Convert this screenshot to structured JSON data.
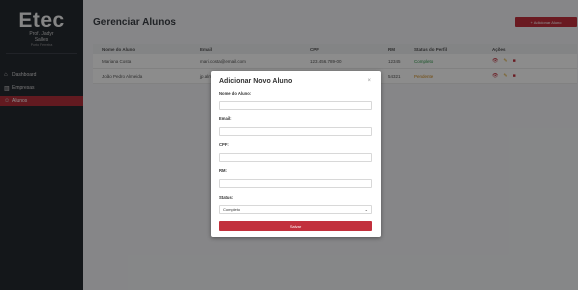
{
  "sidebar": {
    "logo_main": "Etec",
    "logo_sub_1": "Prof. Jadyr",
    "logo_sub_2": "Salles",
    "logo_tag": "Porto Ferreira",
    "items": [
      {
        "label": "Dashboard",
        "icon": "home-icon"
      },
      {
        "label": "Empresas",
        "icon": "building-icon"
      },
      {
        "label": "Alunos",
        "icon": "users-icon",
        "active": true
      }
    ]
  },
  "header": {
    "title": "Gerenciar Alunos",
    "add_button": "+ Adicionar Aluno"
  },
  "table": {
    "headers": [
      "Nome do Aluno",
      "Email",
      "CPF",
      "RM",
      "Status do Perfil",
      "Ações"
    ],
    "rows": [
      {
        "name": "Mariana Costa",
        "email": "mari.costa@email.com",
        "cpf": "123.456.789-00",
        "rm": "12345",
        "status": "Completo"
      },
      {
        "name": "João Pedro Almeida",
        "email": "jp.alm...",
        "cpf": "...",
        "rm": "54321",
        "status": "Pendente"
      }
    ]
  },
  "modal": {
    "title": "Adicionar Novo Aluno",
    "close": "×",
    "fields": {
      "name_label": "Nome do Aluno:",
      "email_label": "Email:",
      "cpf_label": "CPF:",
      "rm_label": "RM:",
      "status_label": "Status:",
      "status_value": "Completo"
    },
    "save_button": "Salvar"
  },
  "colors": {
    "sidebar_bg": "#262a31",
    "accent": "#c2303d",
    "status_complete": "#2e9b4a",
    "status_pending": "#d08a1a"
  }
}
